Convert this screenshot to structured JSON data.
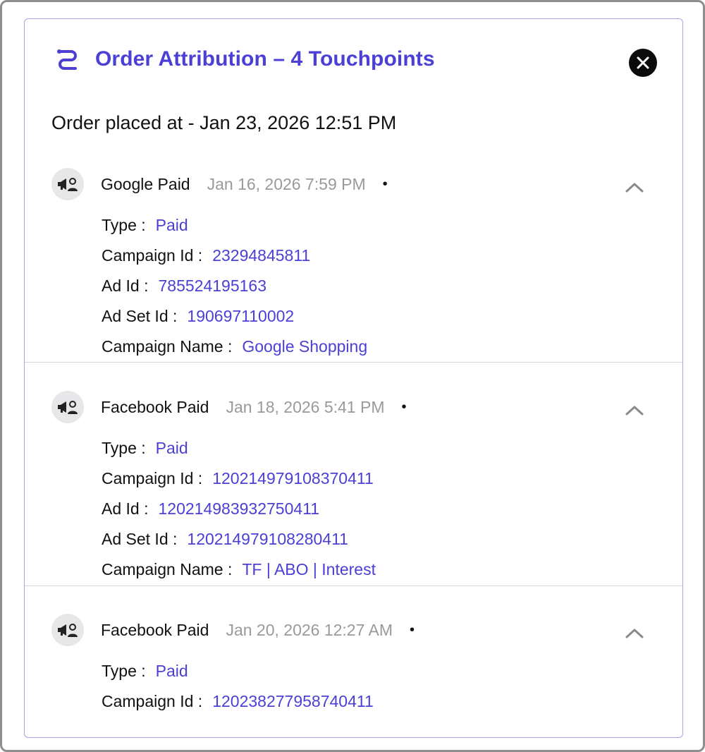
{
  "header": {
    "title": "Order Attribution – 4 Touchpoints"
  },
  "order": {
    "prefix": "Order placed at - ",
    "datetime": "Jan 23, 2026 12:51 PM"
  },
  "colors": {
    "accent": "#4b3fd6",
    "muted_text": "#9a9a9a",
    "divider": "#d6d6d6"
  },
  "touchpoints": [
    {
      "source": "Google Paid",
      "time": "Jan 16, 2026 7:59 PM",
      "dot": "•",
      "icon": "megaphone-user-icon",
      "expanded": true,
      "type_label": "Type :",
      "type_value": "Paid",
      "campaign_id_label": "Campaign Id :",
      "campaign_id": "23294845811",
      "ad_id_label": "Ad Id :",
      "ad_id": "785524195163",
      "ad_set_id_label": "Ad Set Id :",
      "ad_set_id": "190697110002",
      "campaign_name_label": "Campaign Name :",
      "campaign_name": "Google Shopping"
    },
    {
      "source": "Facebook Paid",
      "time": "Jan 18, 2026 5:41 PM",
      "dot": "•",
      "icon": "megaphone-user-icon",
      "expanded": true,
      "type_label": "Type :",
      "type_value": "Paid",
      "campaign_id_label": "Campaign Id :",
      "campaign_id": "120214979108370411",
      "ad_id_label": "Ad Id :",
      "ad_id": "120214983932750411",
      "ad_set_id_label": "Ad Set Id :",
      "ad_set_id": "120214979108280411",
      "campaign_name_label": "Campaign Name :",
      "campaign_name": "TF | ABO | Interest"
    },
    {
      "source": "Facebook Paid",
      "time": "Jan 20, 2026 12:27 AM",
      "dot": "•",
      "icon": "megaphone-user-icon",
      "expanded": true,
      "type_label": "Type :",
      "type_value": "Paid",
      "campaign_id_label": "Campaign Id :",
      "campaign_id": "120238277958740411"
    }
  ]
}
